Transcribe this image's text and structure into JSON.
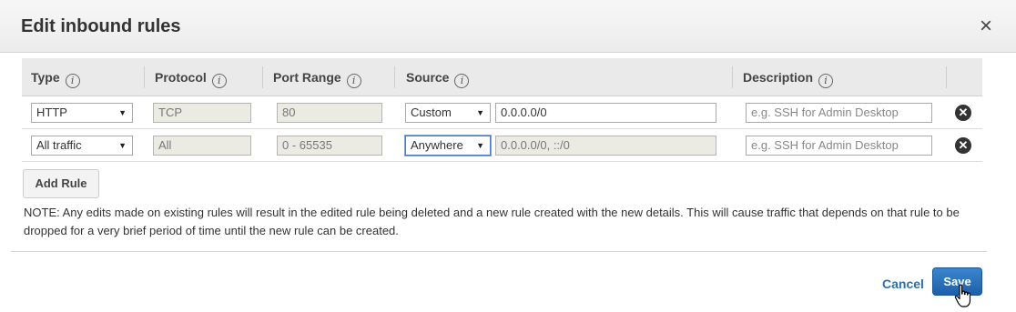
{
  "header": {
    "title": "Edit inbound rules",
    "close_symbol": "×"
  },
  "table": {
    "columns": [
      {
        "label": "Type",
        "info": "i"
      },
      {
        "label": "Protocol",
        "info": "i"
      },
      {
        "label": "Port Range",
        "info": "i"
      },
      {
        "label": "Source",
        "info": "i"
      },
      {
        "label": "Description",
        "info": "i"
      }
    ],
    "rows": [
      {
        "type": "HTTP",
        "protocol": "TCP",
        "port_range": "80",
        "source_mode": "Custom",
        "source_value": "0.0.0.0/0",
        "description_placeholder": "e.g. SSH for Admin Desktop",
        "remove_symbol": "✕"
      },
      {
        "type": "All traffic",
        "protocol": "All",
        "port_range": "0 - 65535",
        "source_mode": "Anywhere",
        "source_value": "0.0.0.0/0, ::/0",
        "description_placeholder": "e.g. SSH for Admin Desktop",
        "remove_symbol": "✕"
      }
    ]
  },
  "add_rule_label": "Add Rule",
  "note": "NOTE: Any edits made on existing rules will result in the edited rule being deleted and a new rule created with the new details. This will cause traffic that depends on that rule to be dropped for a very brief period of time until the new rule can be created.",
  "footer": {
    "cancel_label": "Cancel",
    "save_label": "Save"
  },
  "icons": {
    "info": "info-icon",
    "close": "close-icon",
    "remove": "remove-circle-icon",
    "cursor": "hand-pointer-icon"
  },
  "colors": {
    "primary": "#2f6fa7",
    "save_button": "#2a73bd"
  }
}
